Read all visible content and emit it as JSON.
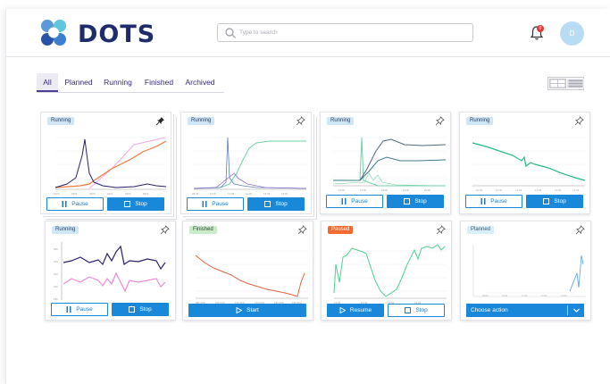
{
  "brand": {
    "name": "DOTS"
  },
  "search": {
    "placeholder": "Type to search"
  },
  "notifications": {
    "count": "0"
  },
  "user": {
    "initial": "D"
  },
  "tabs": [
    {
      "label": "All",
      "active": true
    },
    {
      "label": "Planned"
    },
    {
      "label": "Running"
    },
    {
      "label": "Finished"
    },
    {
      "label": "Archived"
    }
  ],
  "cards": [
    {
      "status": "Running",
      "primary": "Pause",
      "secondary": "Stop",
      "pinned": true
    },
    {
      "status": "Running",
      "primary": "Pause",
      "secondary": "Stop",
      "pinned": false
    },
    {
      "status": "Running",
      "primary": "Pause",
      "secondary": "Stop",
      "pinned": false
    },
    {
      "status": "Running",
      "primary": "Pause",
      "secondary": "Stop",
      "pinned": false
    },
    {
      "status": "Running",
      "primary": "Pause",
      "secondary": "Stop",
      "pinned": false
    },
    {
      "status": "Finished",
      "primary": "Start",
      "pinned": false
    },
    {
      "status": "Paused",
      "primary": "Resume",
      "secondary": "Stop",
      "pinned": false
    },
    {
      "status": "Planned",
      "primary": "Choose action",
      "pinned": false
    }
  ],
  "colors": {
    "brand": "#1f2c6b",
    "accent": "#1a88d8",
    "running_badge": "#cfe6f4",
    "finished_badge": "#c9ebc9",
    "paused_badge": "#f26a2e",
    "planned_badge": "#d8eef8",
    "tab_active": "#4b3f96"
  }
}
